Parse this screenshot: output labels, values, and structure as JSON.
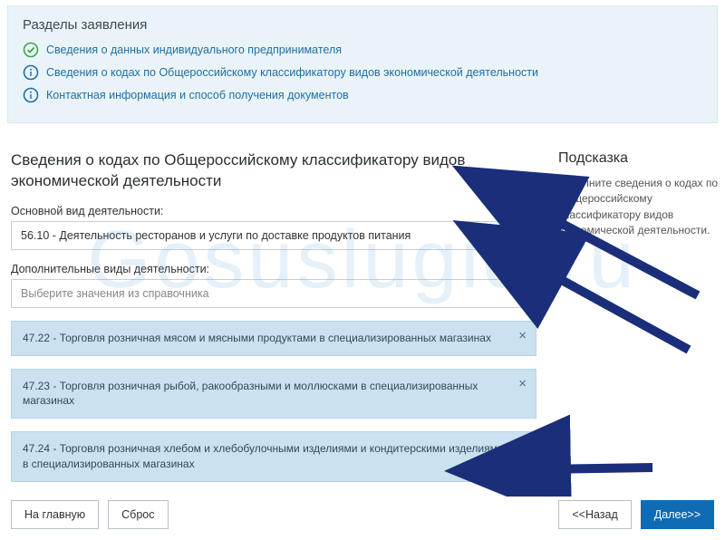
{
  "sections_panel": {
    "title": "Разделы заявления",
    "items": [
      {
        "status": "done",
        "label": "Сведения о данных индивидуального предпринимателя"
      },
      {
        "status": "info",
        "label": "Сведения о кодах по Общероссийскому классификатору видов экономической деятельности"
      },
      {
        "status": "info",
        "label": "Контактная информация и способ получения документов"
      }
    ]
  },
  "main": {
    "heading": "Сведения о кодах по Общероссийскому классификатору видов экономической деятельности",
    "primary_label": "Основной вид деятельности:",
    "primary_value": "56.10 - Деятельность ресторанов и услуги по доставке продуктов питания",
    "additional_label": "Дополнительные виды деятельности:",
    "additional_placeholder": "Выберите значения из справочника",
    "chips": [
      "47.22 - Торговля розничная мясом и мясными продуктами в специализированных магазинах",
      "47.23 - Торговля розничная рыбой, ракообразными и моллюсками в специализированных магазинах",
      "47.24 - Торговля розничная хлебом и хлебобулочными изделиями и кондитерскими изделиями в специализированных магазинах"
    ]
  },
  "hint": {
    "heading": "Подсказка",
    "text": "Заполните сведения о кодах по Общероссийскому классификатору видов экономической деятельности."
  },
  "buttons": {
    "home": "На главную",
    "reset": "Сброс",
    "back": "<<Назад",
    "next": "Далее>>"
  },
  "watermark": "Gosuslugid.ru"
}
